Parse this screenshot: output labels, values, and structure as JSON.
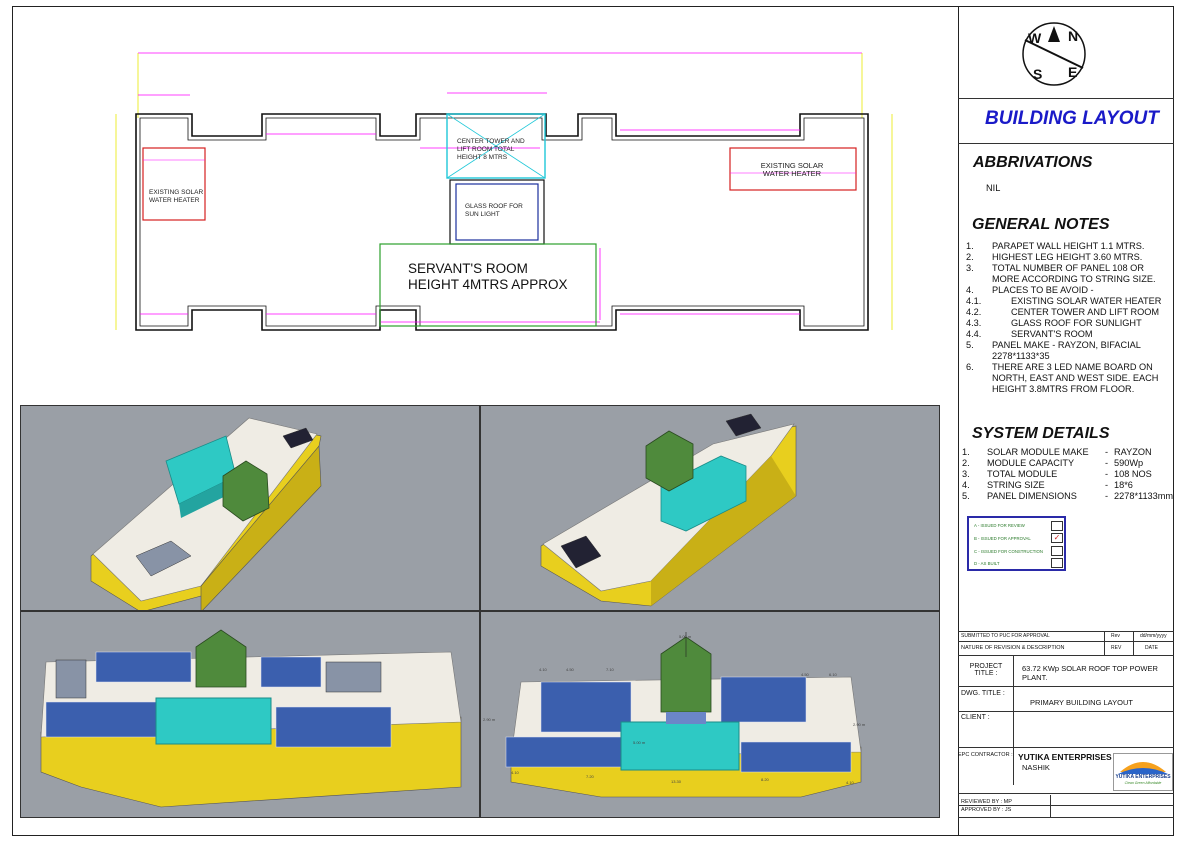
{
  "compass": {
    "n": "N",
    "e": "E",
    "s": "S",
    "w": "W"
  },
  "title": "BUILDING LAYOUT",
  "abbreviations": {
    "heading": "ABBRIVATIONS",
    "value": "NIL"
  },
  "general_notes": {
    "heading": "GENERAL NOTES",
    "items": [
      {
        "num": "1.",
        "text": "PARAPET WALL HEIGHT 1.1 MTRS."
      },
      {
        "num": "2.",
        "text": "HIGHEST LEG HEIGHT 3.60 MTRS."
      },
      {
        "num": "3.",
        "text": "TOTAL NUMBER OF PANEL 108 OR MORE ACCORDING TO STRING SIZE."
      },
      {
        "num": "4.",
        "text": "PLACES TO BE AVOID -"
      },
      {
        "num": "4.1.",
        "text": "EXISTING SOLAR WATER HEATER"
      },
      {
        "num": "4.2.",
        "text": "CENTER TOWER AND LIFT ROOM"
      },
      {
        "num": "4.3.",
        "text": "GLASS ROOF FOR SUNLIGHT"
      },
      {
        "num": "4.4.",
        "text": "SERVANT'S ROOM"
      },
      {
        "num": "5.",
        "text": "PANEL MAKE - RAYZON, BIFACIAL 2278*1133*35"
      },
      {
        "num": "6.",
        "text": "THERE ARE 3 LED NAME BOARD ON NORTH, EAST AND WEST SIDE. EACH HEIGHT 3.8MTRS FROM FLOOR."
      }
    ]
  },
  "system_details": {
    "heading": "SYSTEM DETAILS",
    "rows": [
      {
        "num": "1.",
        "label": "SOLAR MODULE MAKE",
        "value": "RAYZON"
      },
      {
        "num": "2.",
        "label": "MODULE CAPACITY",
        "value": "590Wp"
      },
      {
        "num": "3.",
        "label": "TOTAL MODULE",
        "value": "108 NOS"
      },
      {
        "num": "4.",
        "label": "STRING SIZE",
        "value": "18*6"
      },
      {
        "num": "5.",
        "label": "PANEL DIMENSIONS",
        "value": "2278*1133mm"
      }
    ]
  },
  "status_box": {
    "items": [
      {
        "label": "A - ISSUED FOR REVIEW",
        "checked": false
      },
      {
        "label": "B - ISSUED FOR APPROVAL",
        "checked": true
      },
      {
        "label": "C - ISSUED FOR CONSTRUCTION",
        "checked": false
      },
      {
        "label": "D - AS BUILT",
        "checked": false
      }
    ],
    "check_mark": "✓"
  },
  "revision": {
    "row_text": "SUBMITTED TO PUC FOR APPROVAL",
    "row_rev": "Rev",
    "row_date": "dd/mm/yyyy",
    "header_desc": "NATURE OF REVISION & DESCRIPTION",
    "header_rev": "REV",
    "header_date": "DATE"
  },
  "project": {
    "label": "PROJECT TITLE :",
    "value": "63.72 KWp SOLAR ROOF TOP POWER PLANT."
  },
  "drawing": {
    "label": "DWG. TITLE :",
    "value": "PRIMARY BUILDING LAYOUT"
  },
  "client": {
    "label": "CLIENT :",
    "value": ""
  },
  "contractor": {
    "label": "EPC CONTRACTOR :",
    "name": "YUTIKA ENTERPRISES",
    "city": "NASHIK",
    "logo_text": "YUTIKA ENTERPRISES",
    "logo_tag": "Clean Green Affordable"
  },
  "reviewed_by": "REVIEWED BY : MP",
  "approved_by": "APPROVED BY : JS",
  "plan": {
    "solar_heater_left": "EXISTING SOLAR WATER HEATER",
    "solar_heater_right": "EXISTING SOLAR WATER HEATER",
    "center_tower": "CENTER TOWER AND LIFT ROOM TOTAL HEIGHT 8 MTRS",
    "glass_roof": "GLASS ROOF FOR SUN LIGHT",
    "servant_room_line1": "SERVANT'S ROOM",
    "servant_room_line2": "HEIGHT 4MTRS APPROX"
  },
  "view4_dims": {
    "top_height": "5.00 m",
    "d1": "4.10",
    "d2": "4.50",
    "d3": "7.10",
    "d4": "4.50",
    "d5": "6.10",
    "left": "2.90 m",
    "right": "2.90 m",
    "center": "5.00 m",
    "b1": "4.10",
    "b2": "7.20",
    "b3": "13.30",
    "b4": "8.20",
    "b5": "4.10"
  },
  "colors": {
    "accent_blue": "#1a1ac8",
    "building_yellow": "#e8cf1e",
    "tower_green": "#4f8a3c",
    "tank_cyan": "#2ec9c4",
    "panel_blue": "#3b5fae"
  }
}
